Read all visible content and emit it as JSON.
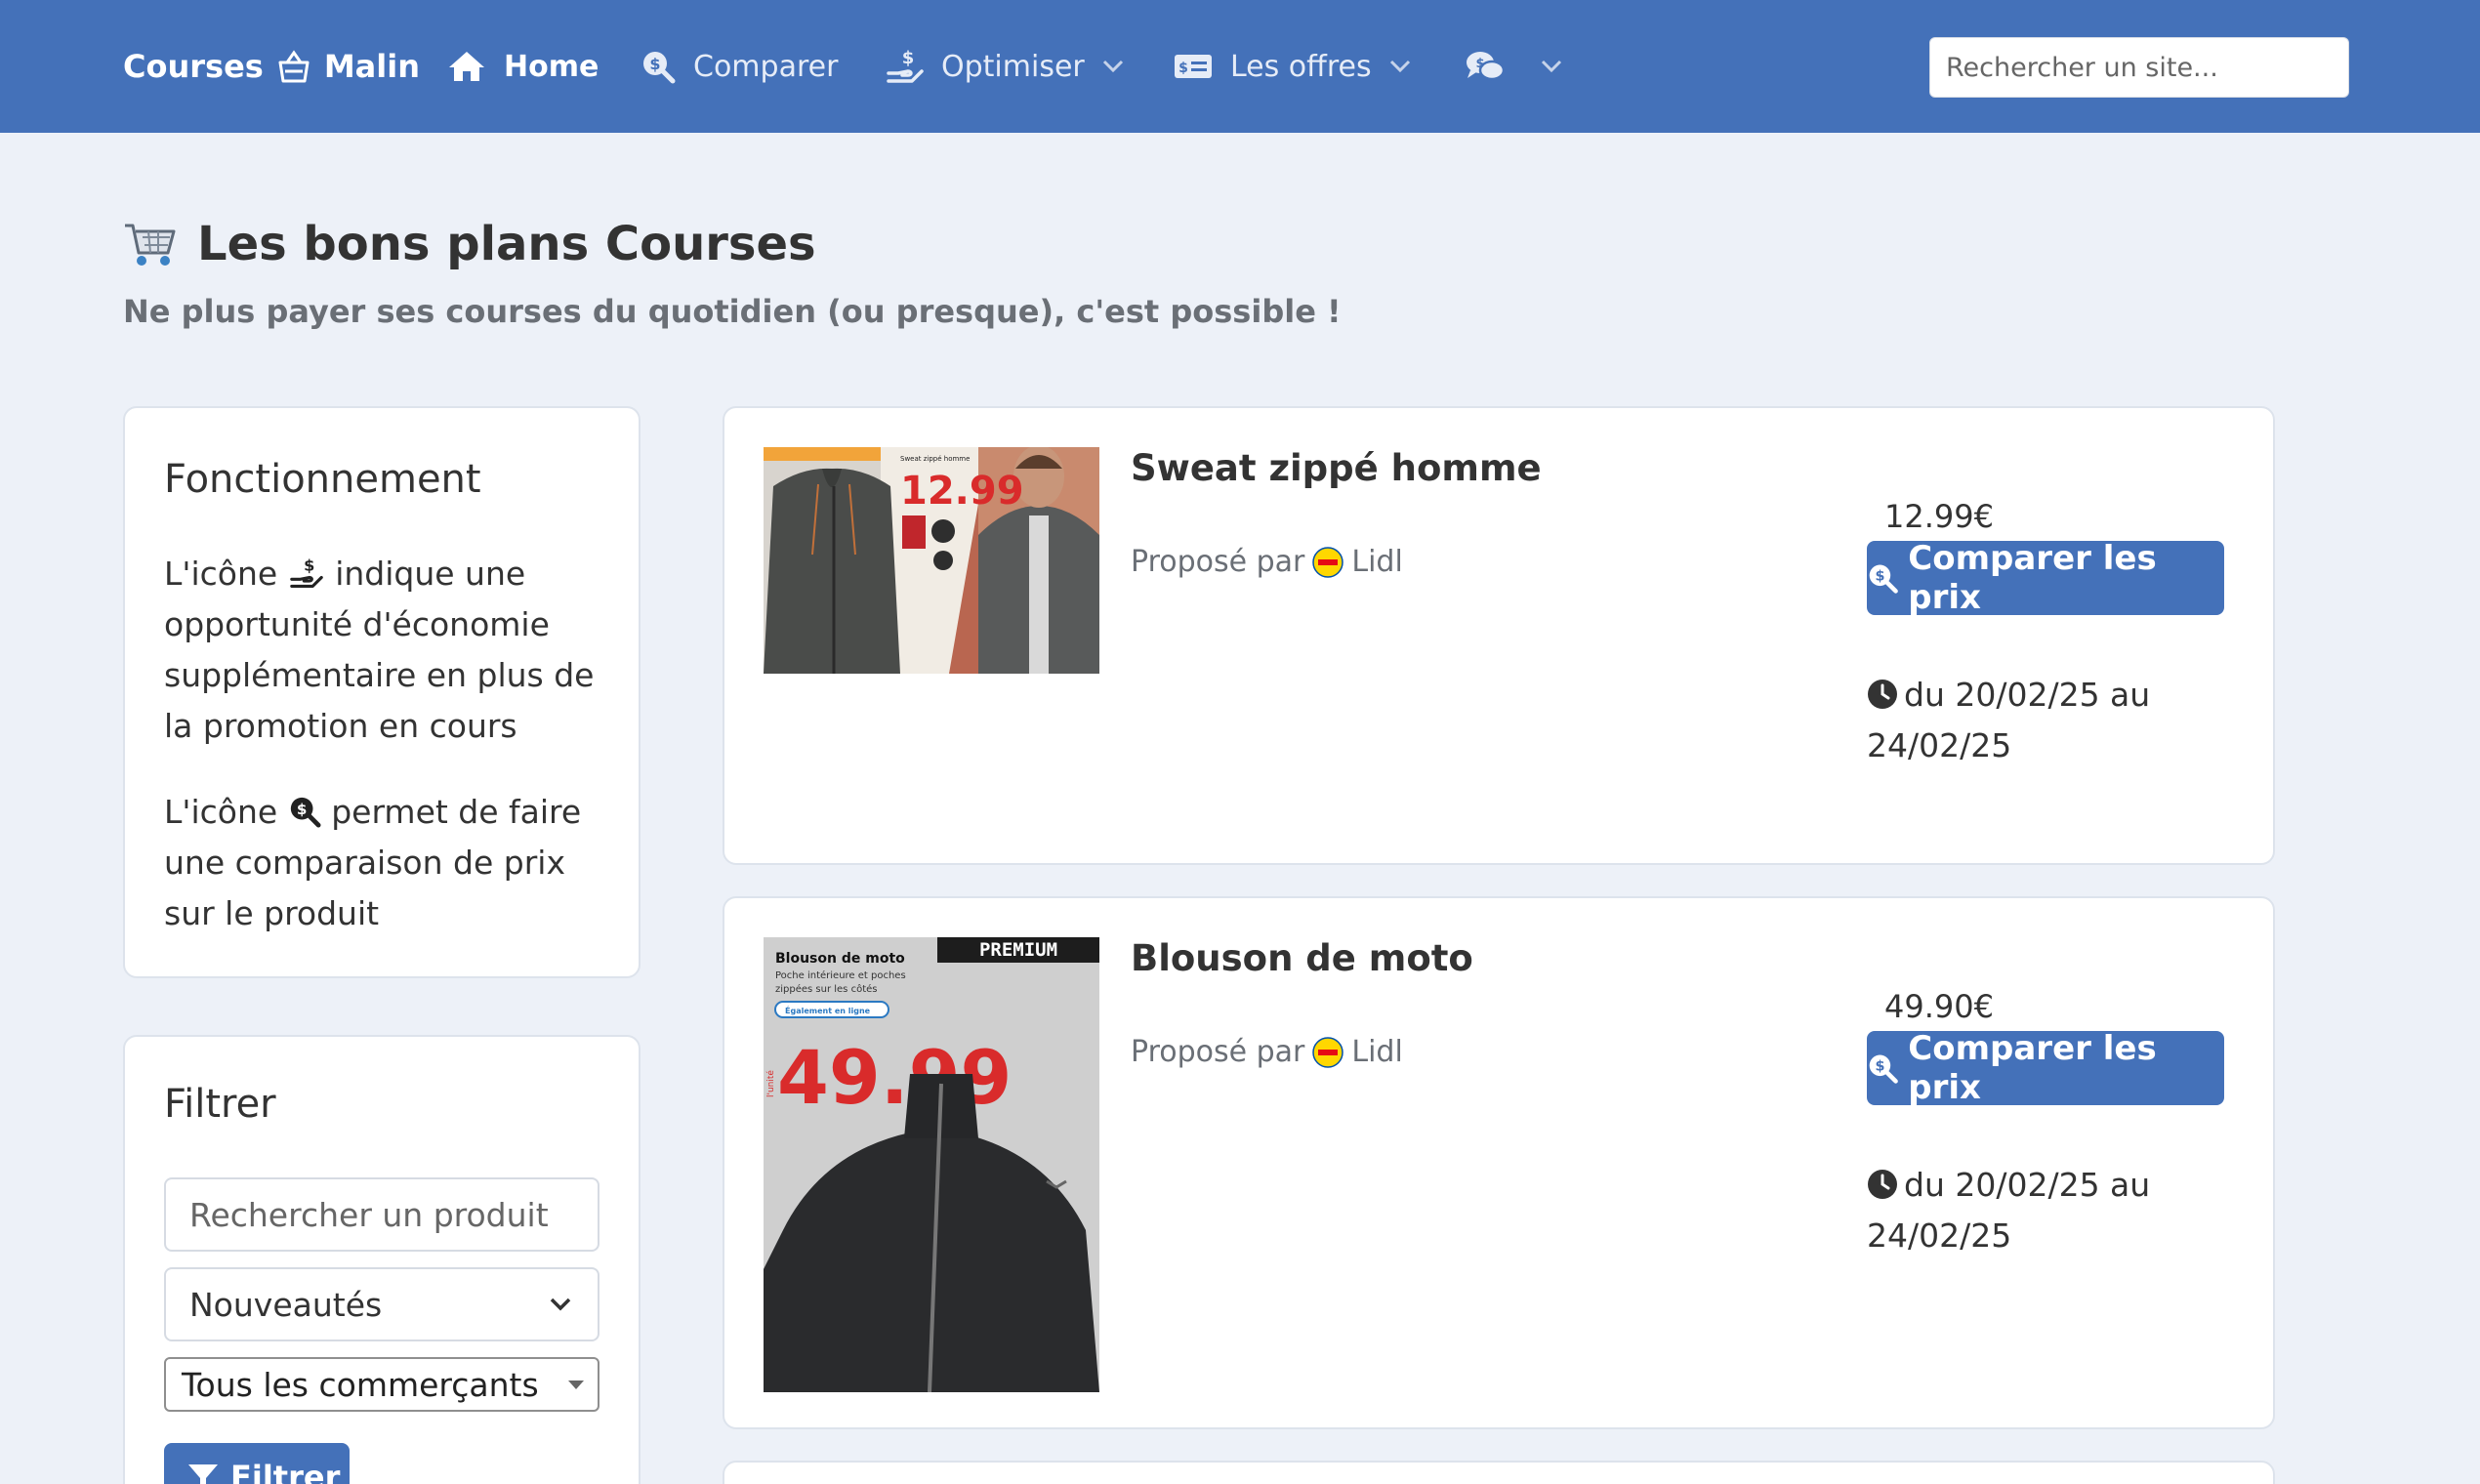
{
  "navbar": {
    "brand_left": "Courses",
    "brand_right": "Malin",
    "items": [
      {
        "label": "Home",
        "icon": "home-icon"
      },
      {
        "label": "Comparer",
        "icon": "search-dollar-icon"
      },
      {
        "label": "Optimiser",
        "icon": "hand-dollar-icon"
      },
      {
        "label": "Les offres",
        "icon": "money-card-icon"
      },
      {
        "label": "",
        "icon": "comments-dollar-icon"
      }
    ],
    "search_placeholder": "Rechercher un site..."
  },
  "header": {
    "title": "Les bons plans Courses",
    "subtitle": "Ne plus payer ses courses du quotidien (ou presque), c'est possible !"
  },
  "sidebar": {
    "how_title": "Fonctionnement",
    "how_p1_before": "L'icône",
    "how_p1_after": "indique une opportunité d'économie supplémentaire en plus de la promotion en cours",
    "how_p2_before": "L'icône",
    "how_p2_after": "permet de faire une comparaison de prix sur le produit",
    "filter_title": "Filtrer",
    "product_search_placeholder": "Rechercher un produit",
    "sort_selected": "Nouveautés",
    "merchant_selected": "Tous les commerçants",
    "filter_button": "Filtrer"
  },
  "products": [
    {
      "title": "Sweat zippé homme",
      "by_label": "Proposé par",
      "merchant": "Lidl",
      "price": "12.99€",
      "compare_label": "Comparer les prix",
      "dates": "du 20/02/25 au 24/02/25",
      "image_price": "12.99",
      "image_small": "Sweat zippé homme"
    },
    {
      "title": "Blouson de moto",
      "by_label": "Proposé par",
      "merchant": "Lidl",
      "price": "49.90€",
      "compare_label": "Comparer les prix",
      "dates": "du 20/02/25 au 24/02/25",
      "image_price": "49.99",
      "image_heading": "Blouson de moto",
      "image_sub1": "Poche intérieure et poches",
      "image_sub2": "zippées sur les côtés",
      "image_badge": "PREMIUM",
      "image_tag": "Également en ligne",
      "image_unit": "l'unité"
    }
  ],
  "colors": {
    "primary": "#4471b9",
    "background": "#edf1f8",
    "lidl_yellow": "#ffd700"
  }
}
